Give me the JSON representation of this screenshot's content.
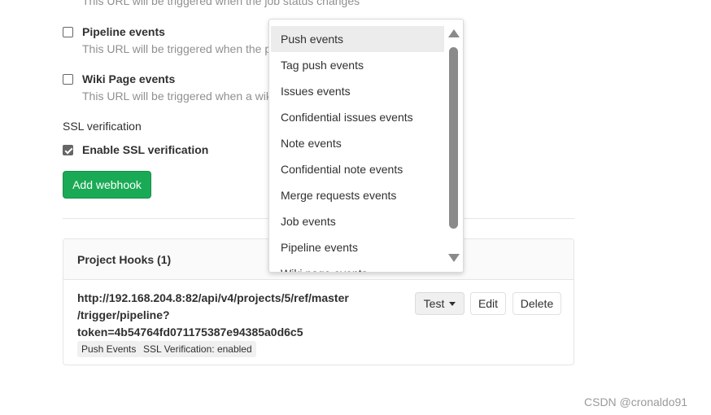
{
  "form": {
    "job_events_help": "This URL will be triggered when the job status changes",
    "pipeline_events": {
      "label": "Pipeline events",
      "help": "This URL will be triggered when the p",
      "checked": false
    },
    "wiki_events": {
      "label": "Wiki Page events",
      "help": "This URL will be triggered when a wik",
      "checked": false
    },
    "ssl_section_label": "SSL verification",
    "ssl": {
      "label": "Enable SSL verification",
      "checked": true
    },
    "add_button_label": "Add webhook"
  },
  "hooks_panel": {
    "title": "Project Hooks (1)",
    "hook": {
      "url_lines": [
        "http://192.168.204.8:82/api/v4/projects/5/ref/master",
        "/trigger/pipeline?",
        "token=4b54764fd071175387e94385a0d6c5"
      ],
      "badges": [
        "Push Events",
        "SSL Verification: enabled"
      ],
      "test_label": "Test",
      "edit_label": "Edit",
      "delete_label": "Delete"
    }
  },
  "test_dropdown": {
    "items": [
      "Push events",
      "Tag push events",
      "Issues events",
      "Confidential issues events",
      "Note events",
      "Confidential note events",
      "Merge requests events",
      "Job events",
      "Pipeline events",
      "Wiki page events"
    ],
    "highlighted_index": 0
  },
  "watermark": "CSDN @cronaldo91",
  "colors": {
    "success": "#1aaa55",
    "text": "#303030",
    "muted": "#909090"
  }
}
